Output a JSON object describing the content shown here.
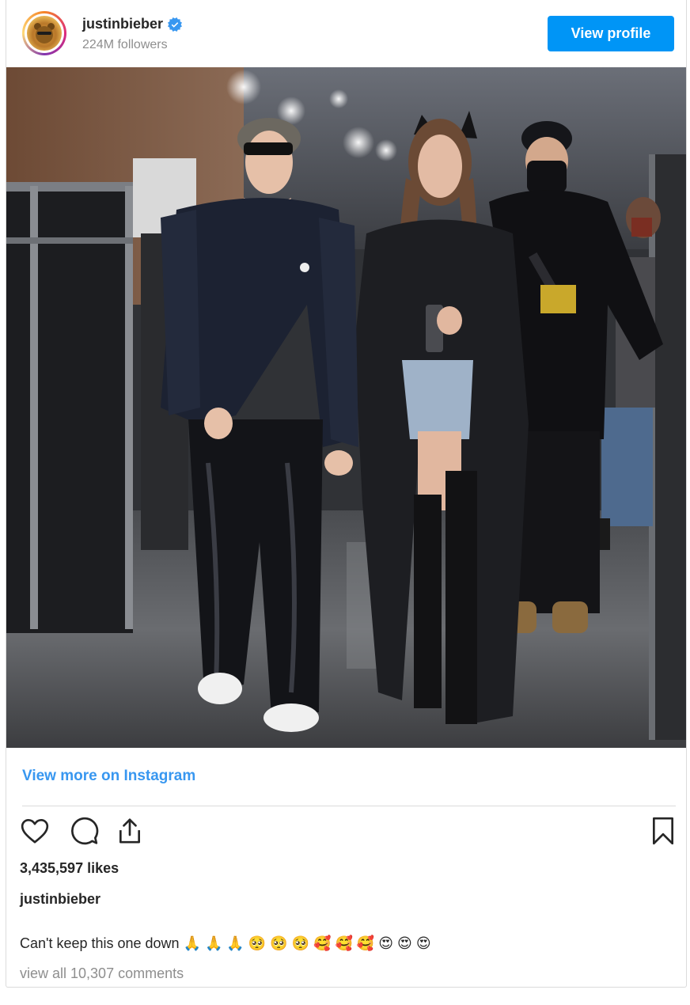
{
  "header": {
    "username": "justinbieber",
    "followers": "224M followers",
    "view_profile_label": "View profile"
  },
  "post": {
    "photo_alt": "Photo by justinbieber",
    "view_more_label": "View more on Instagram",
    "likes": "3,435,597 likes",
    "caption_user": "justinbieber",
    "caption_text": "Can't keep this one down 🙏 🙏 🙏 🥺 🥺 🥺 🥰 🥰 🥰 😍 😍 😍",
    "comments_link": "view all 10,307 comments"
  },
  "icons": {
    "verified": "verified-badge-icon",
    "like": "heart-icon",
    "comment": "comment-icon",
    "share": "share-icon",
    "save": "bookmark-icon"
  },
  "colors": {
    "accent": "#0095f6",
    "link": "#3897f0",
    "muted": "#8e8e8e",
    "text": "#262626"
  }
}
